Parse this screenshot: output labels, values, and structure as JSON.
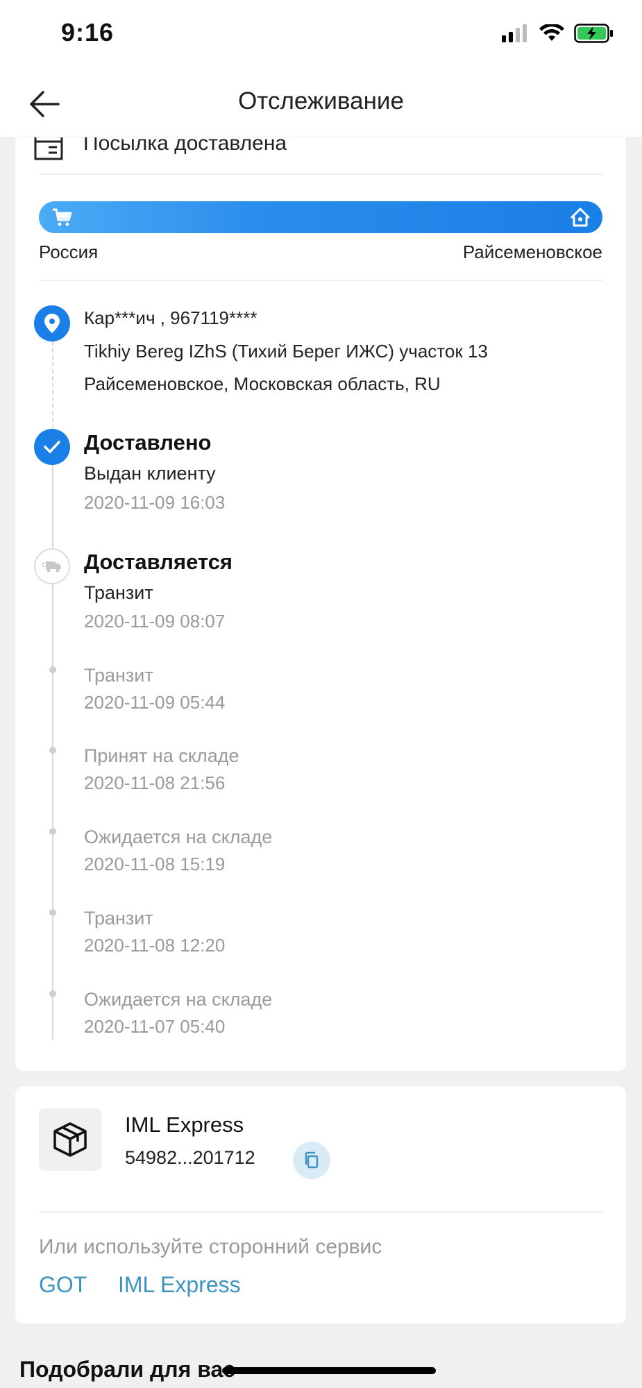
{
  "status_bar": {
    "time": "9:16"
  },
  "nav": {
    "title": "Отслеживание",
    "back_icon": "arrow-left-icon"
  },
  "parcel": {
    "status_text": "Посылка доставлена"
  },
  "route": {
    "from": "Россия",
    "to": "Райсеменовское",
    "accent_color": "#1a7fe6"
  },
  "address": {
    "line1": "Кар***ич , 967119****",
    "line2": "Tikhiy Bereg IZhS (Тихий Берег ИЖС) участок 13",
    "line3": "Райсеменовское, Московская область, RU"
  },
  "events": [
    {
      "status": "Доставлено",
      "desc": "Выдан клиенту",
      "time": "2020-11-09 16:03"
    },
    {
      "status": "Доставляется",
      "desc": "Транзит",
      "time": "2020-11-09 08:07"
    },
    {
      "desc": "Транзит",
      "time": "2020-11-09 05:44"
    },
    {
      "desc": "Принят на складе",
      "time": "2020-11-08 21:56"
    },
    {
      "desc": "Ожидается на складе",
      "time": "2020-11-08 15:19"
    },
    {
      "desc": "Транзит",
      "time": "2020-11-08 12:20"
    },
    {
      "desc": "Ожидается на складе",
      "time": "2020-11-07 05:40"
    }
  ],
  "carrier": {
    "name": "IML Express",
    "tracking_number": "54982...201712",
    "alt_label": "Или используйте сторонний сервис",
    "alt_services": [
      "GOT",
      "IML Express"
    ],
    "link_color": "#3d93c2"
  },
  "recommend": {
    "title": "Подобрали для вас"
  }
}
